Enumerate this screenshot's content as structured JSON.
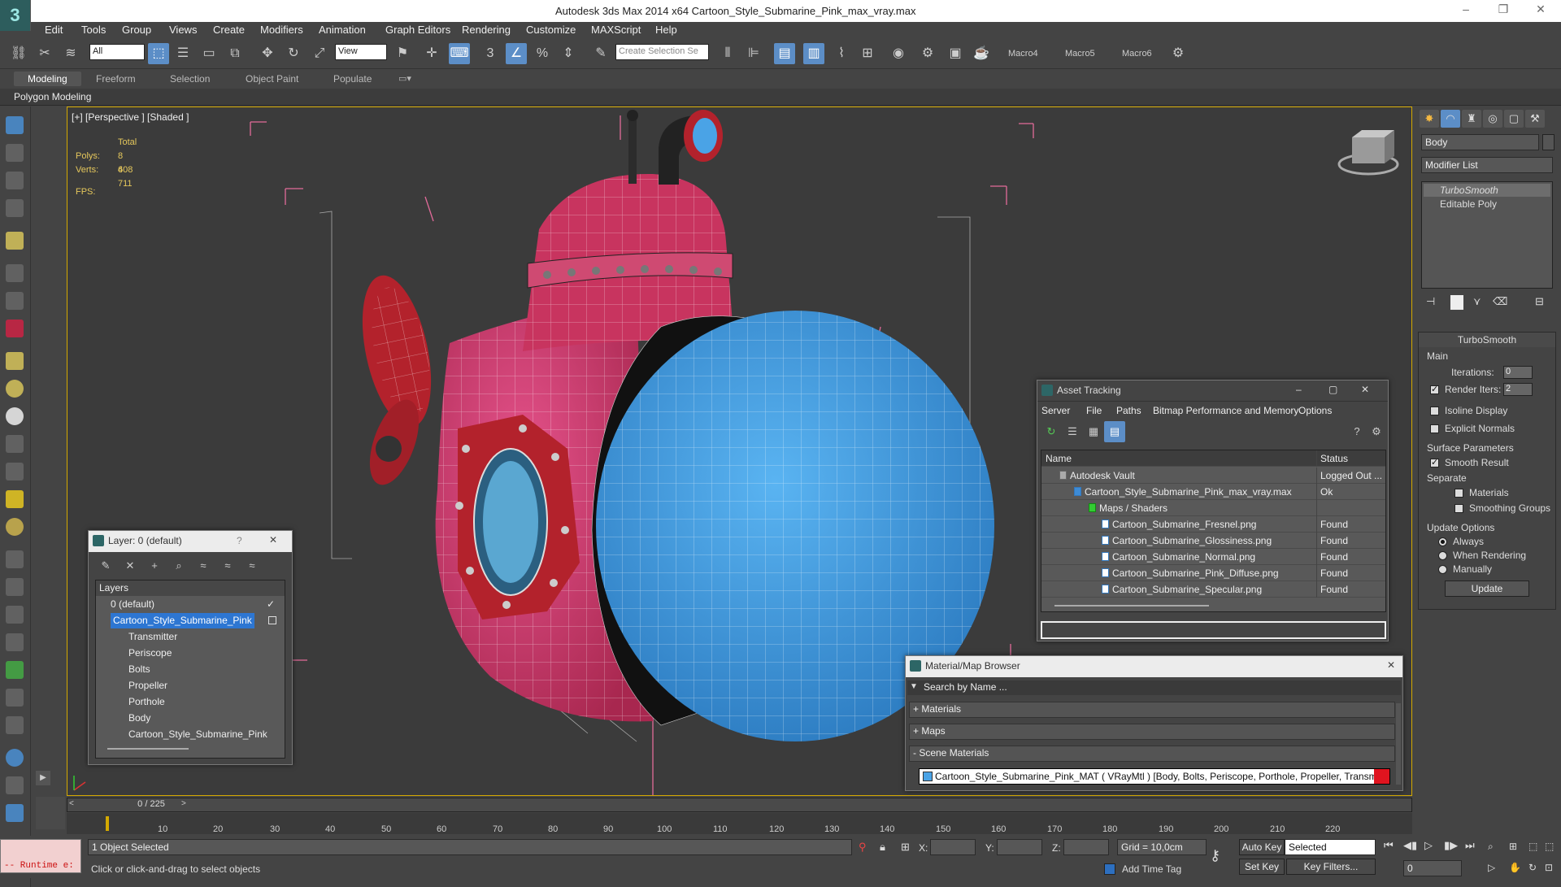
{
  "window": {
    "title": "Autodesk 3ds Max  2014 x64     Cartoon_Style_Submarine_Pink_max_vray.max",
    "minimize": "–",
    "maximize": "❐",
    "close": "✕"
  },
  "logo": "3",
  "menu": [
    "Edit",
    "Tools",
    "Group",
    "Views",
    "Create",
    "Modifiers",
    "Animation",
    "Graph Editors",
    "Rendering",
    "Customize",
    "MAXScript",
    "Help"
  ],
  "toolbar": {
    "filter": "All",
    "refcoord": "View",
    "selection_set_placeholder": "Create Selection Se",
    "macros": [
      "Macro4",
      "Macro5",
      "Macro6"
    ]
  },
  "ribbon": {
    "tabs": [
      "Modeling",
      "Freeform",
      "Selection",
      "Object Paint",
      "Populate"
    ],
    "active": "Modeling"
  },
  "polymod": "Polygon Modeling",
  "viewport": {
    "label": "[+] [Perspective ] [Shaded ]",
    "total": "Total",
    "polys_label": "Polys:",
    "polys": "8 608",
    "verts_label": "Verts:",
    "verts": "4 711",
    "fps_label": "FPS:"
  },
  "command_panel": {
    "object_name": "Body",
    "modifier_list": "Modifier List",
    "stack": [
      "TurboSmooth",
      "Editable Poly"
    ],
    "rollout_title": "TurboSmooth",
    "main": "Main",
    "iterations_label": "Iterations:",
    "iterations": "0",
    "render_iters_label": "Render Iters:",
    "render_iters": "2",
    "isoline": "Isoline Display",
    "explicit": "Explicit Normals",
    "surface_params": "Surface Parameters",
    "smooth_result": "Smooth Result",
    "separate": "Separate",
    "materials": "Materials",
    "smoothing_groups": "Smoothing Groups",
    "update_options": "Update Options",
    "always": "Always",
    "when_rendering": "When Rendering",
    "manually": "Manually",
    "update_btn": "Update"
  },
  "layer_window": {
    "title": "Layer: 0 (default)",
    "help": "?",
    "close": "✕",
    "header": "Layers",
    "default_layer": "0 (default)",
    "selected_layer": "Cartoon_Style_Submarine_Pink",
    "objects": [
      "Transmitter",
      "Periscope",
      "Bolts",
      "Propeller",
      "Porthole",
      "Body",
      "Cartoon_Style_Submarine_Pink"
    ]
  },
  "asset_window": {
    "title": "Asset Tracking",
    "menu": [
      "Server",
      "File",
      "Paths",
      "Bitmap Performance and Memory",
      "Options"
    ],
    "col_name": "Name",
    "col_status": "Status",
    "rows": [
      {
        "name": "Autodesk Vault",
        "status": "Logged Out ...",
        "indent": 0
      },
      {
        "name": "Cartoon_Style_Submarine_Pink_max_vray.max",
        "status": "Ok",
        "indent": 1
      },
      {
        "name": "Maps / Shaders",
        "status": "",
        "indent": 2
      },
      {
        "name": "Cartoon_Submarine_Fresnel.png",
        "status": "Found",
        "indent": 3
      },
      {
        "name": "Cartoon_Submarine_Glossiness.png",
        "status": "Found",
        "indent": 3
      },
      {
        "name": "Cartoon_Submarine_Normal.png",
        "status": "Found",
        "indent": 3
      },
      {
        "name": "Cartoon_Submarine_Pink_Diffuse.png",
        "status": "Found",
        "indent": 3
      },
      {
        "name": "Cartoon_Submarine_Specular.png",
        "status": "Found",
        "indent": 3
      }
    ]
  },
  "material_window": {
    "title": "Material/Map Browser",
    "search_placeholder": "Search by Name ...",
    "sections": [
      "+ Materials",
      "+ Maps",
      "- Scene Materials"
    ],
    "item": "Cartoon_Style_Submarine_Pink_MAT ( VRayMtl ) [Body, Bolts, Periscope, Porthole, Propeller, Transmitter]"
  },
  "timeline": {
    "frame": "0 / 225",
    "ticks": [
      "10",
      "20",
      "30",
      "40",
      "50",
      "60",
      "70",
      "80",
      "90",
      "100",
      "110",
      "120",
      "130",
      "140",
      "150",
      "160",
      "170",
      "180",
      "190",
      "200",
      "210",
      "220"
    ]
  },
  "status": {
    "objects_selected": "1 Object Selected",
    "prompt": "Click or click-and-drag to select objects",
    "runtime": "-- Runtime e:",
    "x_label": "X:",
    "y_label": "Y:",
    "z_label": "Z:",
    "grid": "Grid = 10,0cm",
    "auto_key": "Auto Key",
    "set_key": "Set Key",
    "selected": "Selected",
    "key_filters": "Key Filters...",
    "add_time_tag": "Add Time Tag",
    "frame_field": "0"
  },
  "colors": {
    "accent": "#5c8ec7",
    "viewport_border": "#d4a900",
    "pink": "#d9457b",
    "blue": "#4aa3e6",
    "red": "#b3222c"
  }
}
